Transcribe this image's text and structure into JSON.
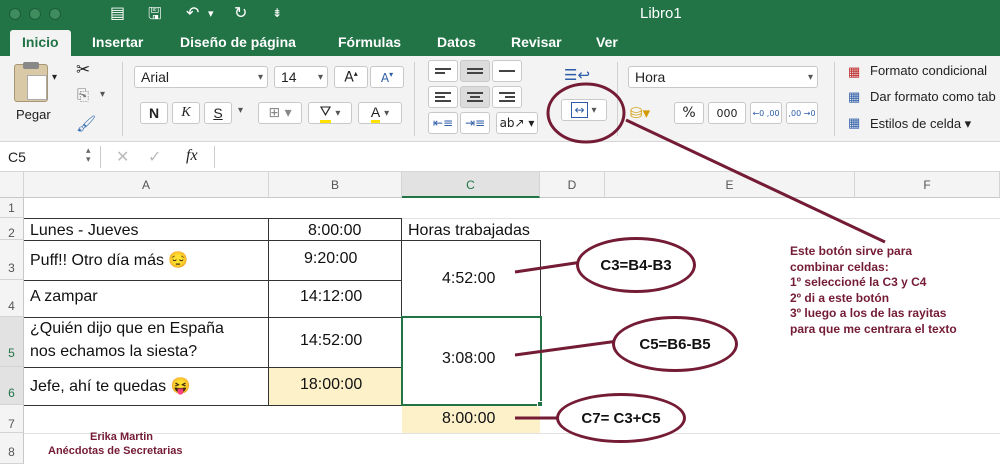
{
  "window": {
    "title": "Libro1"
  },
  "tabs": [
    "Inicio",
    "Insertar",
    "Diseño de página",
    "Fórmulas",
    "Datos",
    "Revisar",
    "Ver"
  ],
  "ribbon": {
    "paste_label": "Pegar",
    "font_name": "Arial",
    "font_size": "14",
    "bold": "N",
    "italic": "K",
    "underline": "S",
    "number_format": "Hora",
    "percent": "%",
    "thousands": "000",
    "inc_decimals": "←0 ,00",
    "dec_decimals": ",00 →0",
    "conditional_format": "Formato condicional",
    "format_as_table": "Dar formato como tab",
    "cell_styles": "Estilos de celda"
  },
  "formula_bar": {
    "name_box": "C5",
    "fx": "fx",
    "value": ""
  },
  "columns": [
    "A",
    "B",
    "C",
    "D",
    "E",
    "F"
  ],
  "rows": [
    "1",
    "2",
    "3",
    "4",
    "5",
    "6",
    "7",
    "8"
  ],
  "cells": {
    "a2": "Lunes - Jueves",
    "b2": "8:00:00",
    "c2": "Horas trabajadas",
    "a3": "Puff!! Otro día más 😔",
    "b3": "9:20:00",
    "c3": "4:52:00",
    "a4": "A zampar",
    "b4": "14:12:00",
    "a5": "¿Quién dijo que en España",
    "a5b": "nos echamos la siesta?",
    "b5": "14:52:00",
    "c5": "3:08:00",
    "a6": "Jefe, ahí te quedas 😝",
    "b6": "18:00:00",
    "c7": "8:00:00"
  },
  "annotations": {
    "note_lines": [
      "Este botón sirve para",
      "combinar celdas:",
      "1º seleccioné la C3 y C4",
      "2º di a este botón",
      "3º luego a los de las rayitas",
      "para que me centrara el texto"
    ],
    "oval1": "C3=B4-B3",
    "oval2": "C5=B6-B5",
    "oval3": "C7= C3+C5",
    "author": "Erika Martin",
    "blog": "Anécdotas de Secretarias"
  },
  "colors": {
    "excel_green": "#227447",
    "annotation": "#741b35",
    "highlight": "#fdf1c9"
  }
}
